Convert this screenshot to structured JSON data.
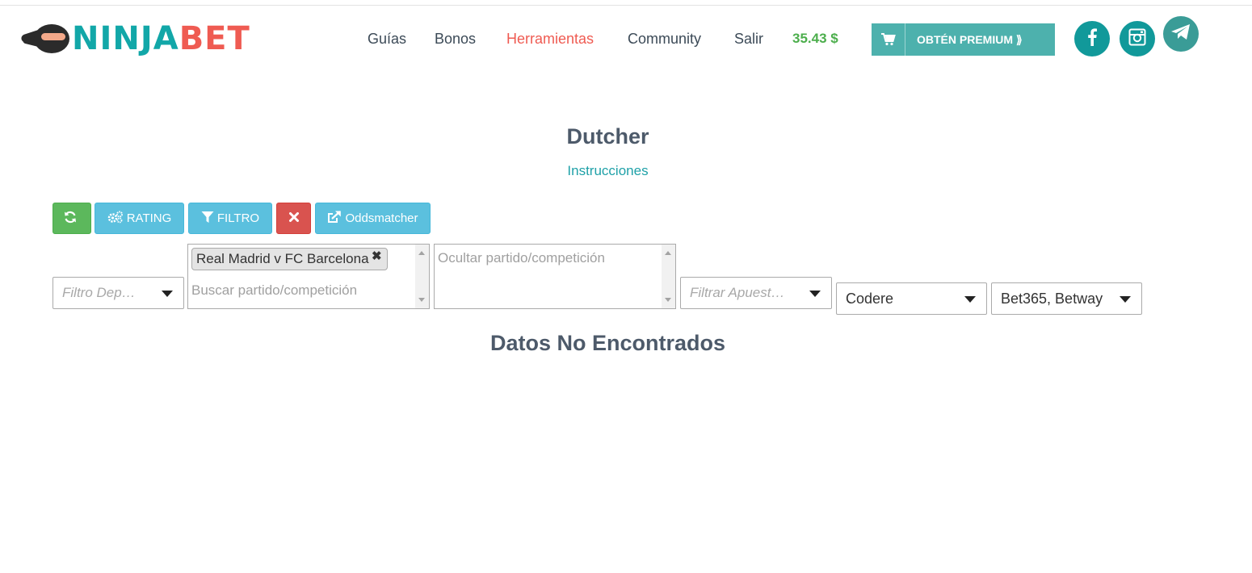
{
  "header": {
    "logo": {
      "part1": "NINJA",
      "part2": "BET"
    },
    "nav": [
      {
        "label": "Guías",
        "active": false
      },
      {
        "label": "Bonos",
        "active": false
      },
      {
        "label": "Herramientas",
        "active": true
      },
      {
        "label": "Community",
        "active": false
      },
      {
        "label": "Salir",
        "active": false
      }
    ],
    "balance": "35.43 $",
    "premium_label": "OBTÉN PREMIUM ⟫",
    "social": [
      "facebook-icon",
      "instagram-icon",
      "telegram-icon"
    ]
  },
  "main": {
    "title": "Dutcher",
    "instructions_link": "Instrucciones",
    "toolbar": {
      "refresh_icon": "refresh-icon",
      "rating_label": "RATING",
      "filter_label": "FILTRO",
      "clear_icon": "close-icon",
      "oddsmatcher_label": "Oddsmatcher"
    },
    "filters": {
      "sport_placeholder": "Filtro Dep…",
      "match_selected_tag": "Real Madrid v FC Barcelona",
      "match_search_placeholder": "Buscar partido/competición",
      "hide_placeholder": "Ocultar partido/competición",
      "bet_placeholder": "Filtrar Apuest…",
      "bookmaker_value": "Codere",
      "exchange_value": "Bet365, Betway"
    },
    "no_data_message": "Datos No Encontrados"
  },
  "colors": {
    "brand_teal": "#12a7a8",
    "brand_red": "#ef5b52",
    "balance_green": "#4cae4c",
    "premium_bg": "#4db1ad",
    "btn_green": "#5cb85c",
    "btn_blue": "#5bc0de",
    "btn_red": "#d9534f"
  }
}
